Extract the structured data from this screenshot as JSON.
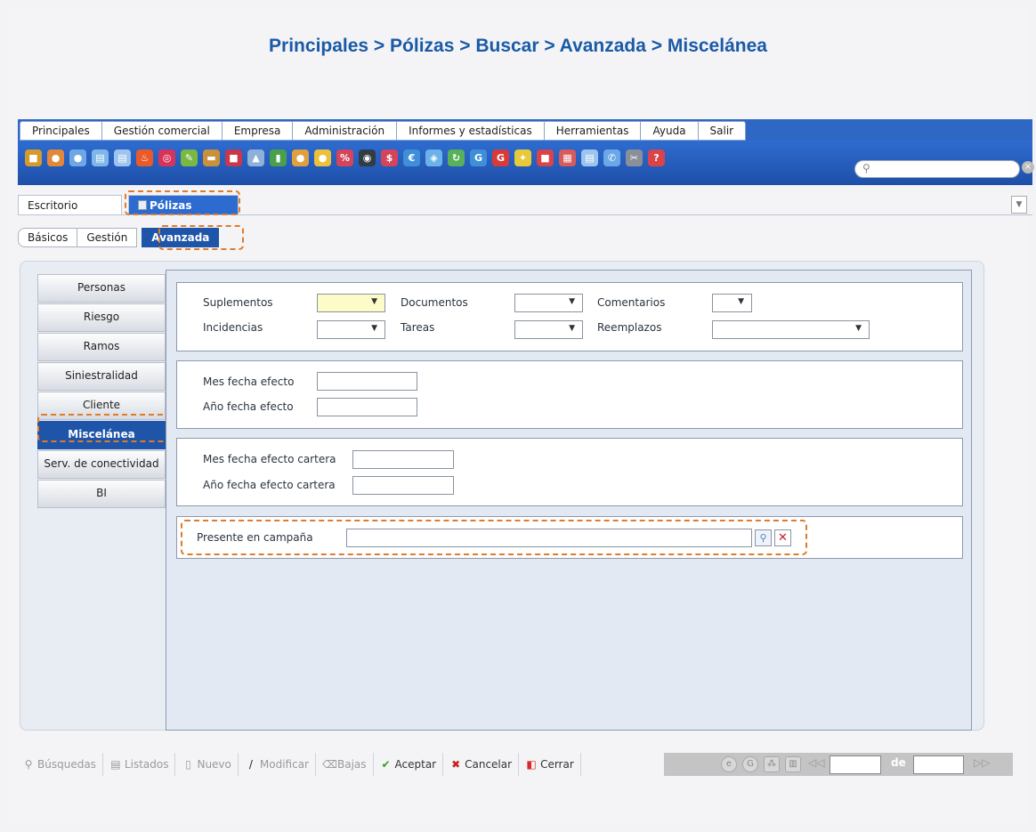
{
  "title": "Principales > Pólizas > Buscar > Avanzada > Miscelánea",
  "menu": [
    "Principales",
    "Gestión comercial",
    "Empresa",
    "Administración",
    "Informes y estadísticas",
    "Herramientas",
    "Ayuda",
    "Salir"
  ],
  "window_tabs": {
    "escritorio": "Escritorio",
    "polizas": "Pólizas"
  },
  "sub_tabs": {
    "basicos": "Básicos",
    "gestion": "Gestión",
    "avanzada": "Avanzada"
  },
  "sidebar": [
    "Personas",
    "Riesgo",
    "Ramos",
    "Siniestralidad",
    "Cliente",
    "Miscelánea",
    "Serv. de conectividad",
    "BI"
  ],
  "panel1": {
    "suplementos": "Suplementos",
    "documentos": "Documentos",
    "comentarios": "Comentarios",
    "incidencias": "Incidencias",
    "tareas": "Tareas",
    "reemplazos": "Reemplazos"
  },
  "panel2": {
    "mes": "Mes fecha efecto",
    "anio": "Año fecha efecto"
  },
  "panel3": {
    "mes": "Mes fecha efecto cartera",
    "anio": "Año fecha efecto cartera"
  },
  "panel4": {
    "presente": "Presente en campaña"
  },
  "bottom": {
    "busquedas": "Búsquedas",
    "listados": "Listados",
    "nuevo": "Nuevo",
    "modificar": "Modificar",
    "bajas": "Bajas",
    "aceptar": "Aceptar",
    "cancelar": "Cancelar",
    "cerrar": "Cerrar",
    "de": "de"
  },
  "colors": {
    "title": "#1a5aa6",
    "menu_blue": "#2f67c5",
    "active_tab": "#1f55a8",
    "highlight": "#e07b2a"
  }
}
